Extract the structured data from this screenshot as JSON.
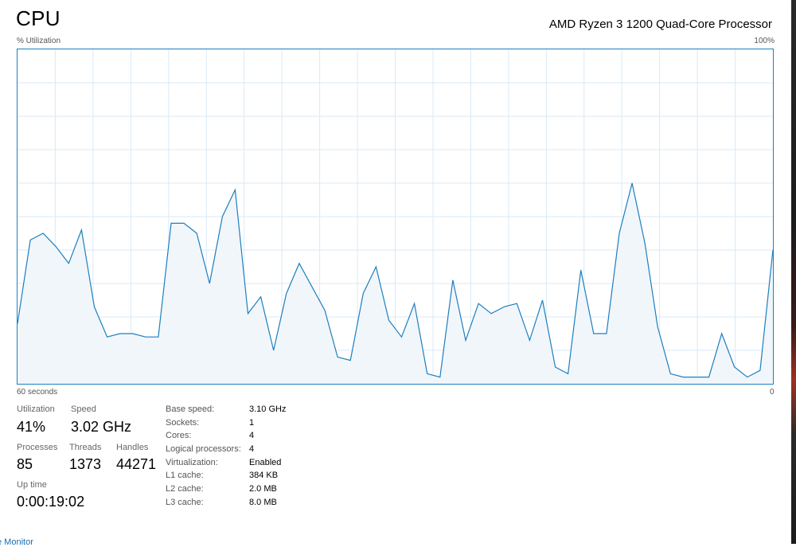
{
  "header": {
    "title": "CPU",
    "processor": "AMD Ryzen 3 1200 Quad-Core Processor"
  },
  "graph": {
    "y_label": "% Utilization",
    "y_max_label": "100%",
    "x_left_label": "60 seconds",
    "x_right_label": "0",
    "line_color": "#1c7fbf",
    "fill_color": "#f1f6fb",
    "grid_color": "#d9eaf5",
    "utilization_percent": [
      18,
      43,
      45,
      41,
      36,
      46,
      23,
      14,
      15,
      15,
      14,
      14,
      48,
      48,
      45,
      30,
      50,
      58,
      21,
      26,
      10,
      27,
      36,
      29,
      22,
      8,
      7,
      27,
      35,
      19,
      14,
      24,
      3,
      2,
      31,
      13,
      24,
      21,
      23,
      24,
      13,
      25,
      5,
      3,
      34,
      15,
      15,
      45,
      60,
      42,
      17,
      3,
      2,
      2,
      2,
      15,
      5,
      2,
      4,
      40
    ]
  },
  "stats": {
    "utilization_label": "Utilization",
    "utilization_value": "41%",
    "speed_label": "Speed",
    "speed_value": "3.02 GHz",
    "processes_label": "Processes",
    "processes_value": "85",
    "threads_label": "Threads",
    "threads_value": "1373",
    "handles_label": "Handles",
    "handles_value": "44271",
    "uptime_label": "Up time",
    "uptime_value": "0:00:19:02"
  },
  "specs": [
    {
      "label": "Base speed:",
      "value": "3.10 GHz"
    },
    {
      "label": "Sockets:",
      "value": "1"
    },
    {
      "label": "Cores:",
      "value": "4"
    },
    {
      "label": "Logical processors:",
      "value": "4"
    },
    {
      "label": "Virtualization:",
      "value": "Enabled"
    },
    {
      "label": "L1 cache:",
      "value": "384 KB"
    },
    {
      "label": "L2 cache:",
      "value": "2.0 MB"
    },
    {
      "label": "L3 cache:",
      "value": "8.0 MB"
    }
  ],
  "footer": {
    "link_text": "e Monitor"
  }
}
